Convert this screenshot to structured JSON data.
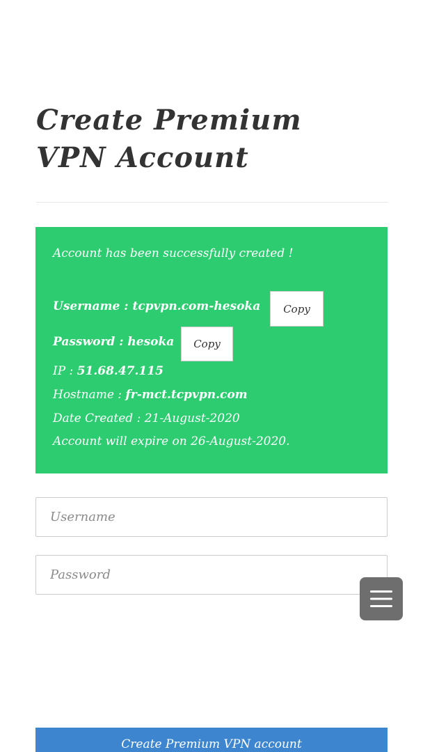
{
  "page": {
    "title": "Create Premium VPN Account"
  },
  "result": {
    "message": "Account has been successfully created !",
    "username_label": "Username : ",
    "username_value": "tcpvpn.com-hesoka",
    "password_label": "Password : ",
    "password_value": "hesoka",
    "ip_label": "IP : ",
    "ip_value": "51.68.47.115",
    "hostname_label": "Hostname : ",
    "hostname_value": "fr-mct.tcpvpn.com",
    "date_created": "Date Created : 21-August-2020",
    "expiry": "Account will expire on 26-August-2020.",
    "copy_label": "Copy"
  },
  "form": {
    "username_placeholder": "Username",
    "password_placeholder": "Password",
    "submit_label": "Create Premium VPN account"
  },
  "colors": {
    "success": "#2ecc71",
    "primary": "#3d86cf",
    "menu": "#6e6e6e"
  },
  "icons": {
    "menu": "hamburger-menu-icon"
  }
}
